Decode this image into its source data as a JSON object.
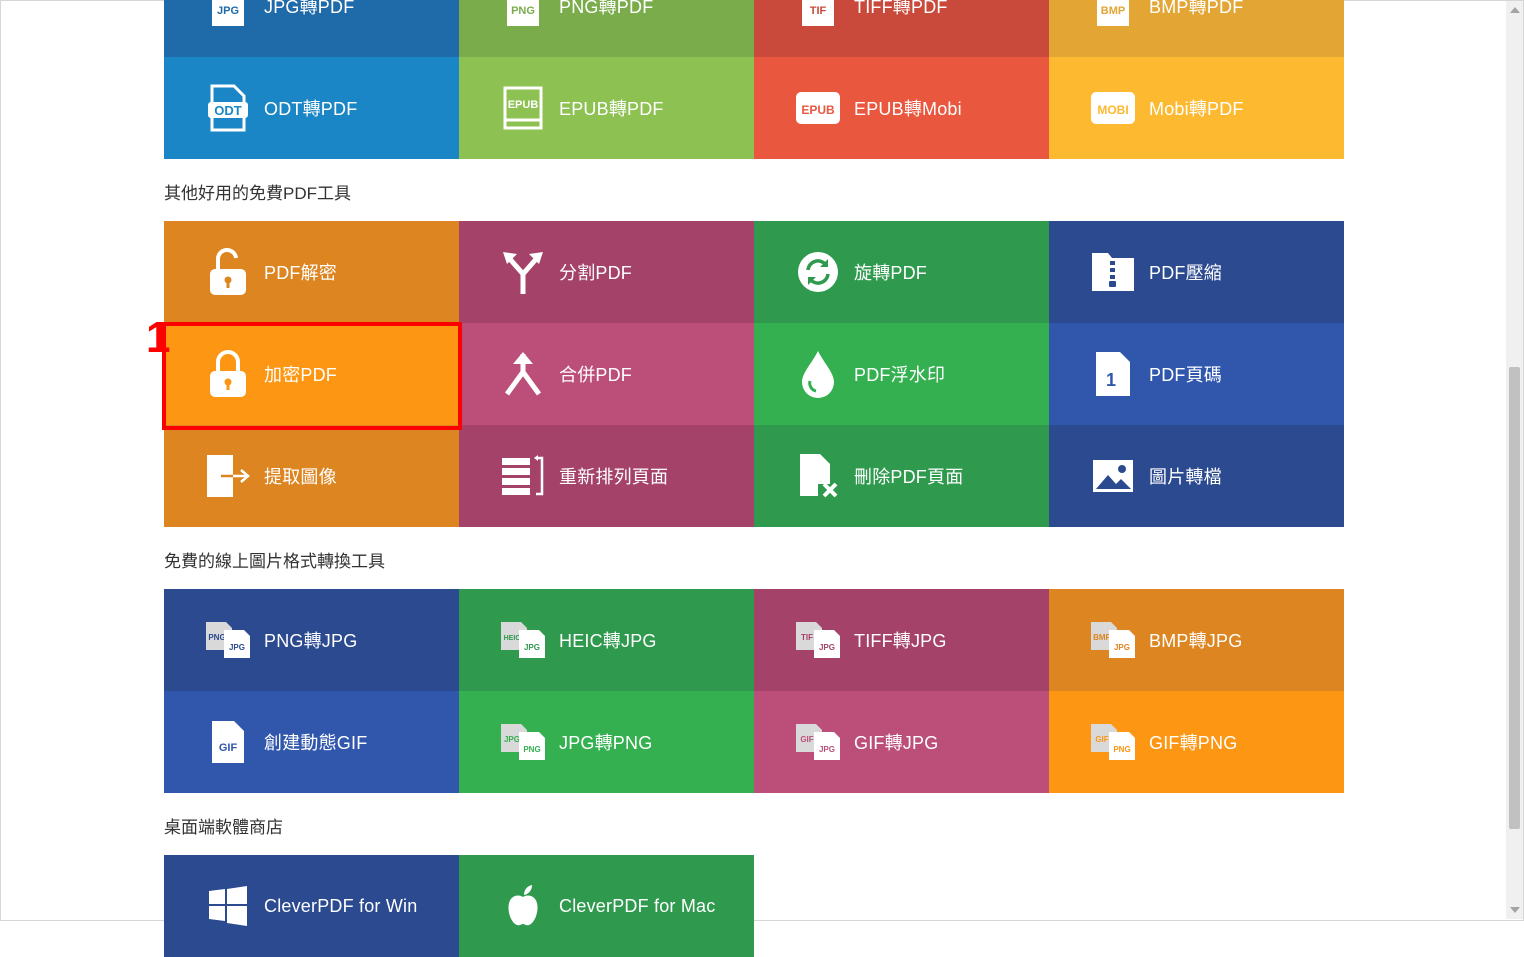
{
  "colors": {
    "blue_dark": "#2b4a8f",
    "blue": "#3157ad",
    "blue_top": "#1f6aa8",
    "odt_blue": "#1b86c6",
    "green_dark": "#2f9a4e",
    "green": "#34b050",
    "lime": "#8dc152",
    "lime_top": "#7aac4b",
    "red": "#e9573f",
    "red_top": "#c9493a",
    "maroon": "#a4426a",
    "pink": "#bb4f79",
    "orange": "#dd8520",
    "orange_bright": "#fc9613",
    "yellow": "#fdb92f",
    "yellow_top": "#e3a534",
    "annotation": "#ff0000"
  },
  "top_row": [
    {
      "label": "JPG轉PDF",
      "icon": "jpg-file-icon"
    },
    {
      "label": "PNG轉PDF",
      "icon": "png-file-icon"
    },
    {
      "label": "TIFF轉PDF",
      "icon": "tiff-file-icon"
    },
    {
      "label": "BMP轉PDF",
      "icon": "bmp-file-icon"
    }
  ],
  "ebook_row": [
    {
      "label": "ODT轉PDF",
      "icon": "odt-file-icon"
    },
    {
      "label": "EPUB轉PDF",
      "icon": "epub-book-icon"
    },
    {
      "label": "EPUB轉Mobi",
      "icon": "epub-badge-icon"
    },
    {
      "label": "Mobi轉PDF",
      "icon": "mobi-badge-icon"
    }
  ],
  "sections": {
    "tools_title": "其他好用的免費PDF工具",
    "image_title": "免費的線上圖片格式轉換工具",
    "store_title": "桌面端軟體商店"
  },
  "tools": [
    {
      "label": "PDF解密",
      "icon": "unlock-icon"
    },
    {
      "label": "分割PDF",
      "icon": "split-arrows-icon"
    },
    {
      "label": "旋轉PDF",
      "icon": "rotate-icon"
    },
    {
      "label": "PDF壓縮",
      "icon": "zip-folder-icon"
    },
    {
      "label": "加密PDF",
      "icon": "lock-icon"
    },
    {
      "label": "合併PDF",
      "icon": "merge-arrows-icon"
    },
    {
      "label": "PDF浮水印",
      "icon": "water-drop-icon"
    },
    {
      "label": "PDF頁碼",
      "icon": "page-number-icon"
    },
    {
      "label": "提取圖像",
      "icon": "extract-icon"
    },
    {
      "label": "重新排列頁面",
      "icon": "reorder-pages-icon"
    },
    {
      "label": "刪除PDF頁面",
      "icon": "delete-page-icon"
    },
    {
      "label": "圖片轉檔",
      "icon": "image-icon"
    }
  ],
  "image_tools": [
    {
      "label": "PNG轉JPG",
      "from": "PNG",
      "to": "JPG"
    },
    {
      "label": "HEIC轉JPG",
      "from": "HEIC",
      "to": "JPG"
    },
    {
      "label": "TIFF轉JPG",
      "from": "TIF",
      "to": "JPG"
    },
    {
      "label": "BMP轉JPG",
      "from": "BMP",
      "to": "JPG"
    },
    {
      "label": "創建動態GIF",
      "from": "",
      "to": "GIF"
    },
    {
      "label": "JPG轉PNG",
      "from": "JPG",
      "to": "PNG"
    },
    {
      "label": "GIF轉JPG",
      "from": "GIF",
      "to": "JPG"
    },
    {
      "label": "GIF轉PNG",
      "from": "GIF",
      "to": "PNG"
    }
  ],
  "store": [
    {
      "label": "CleverPDF for Win",
      "icon": "windows-logo-icon"
    },
    {
      "label": "CleverPDF for Mac",
      "icon": "apple-logo-icon"
    }
  ],
  "annotation": {
    "number": "1"
  }
}
